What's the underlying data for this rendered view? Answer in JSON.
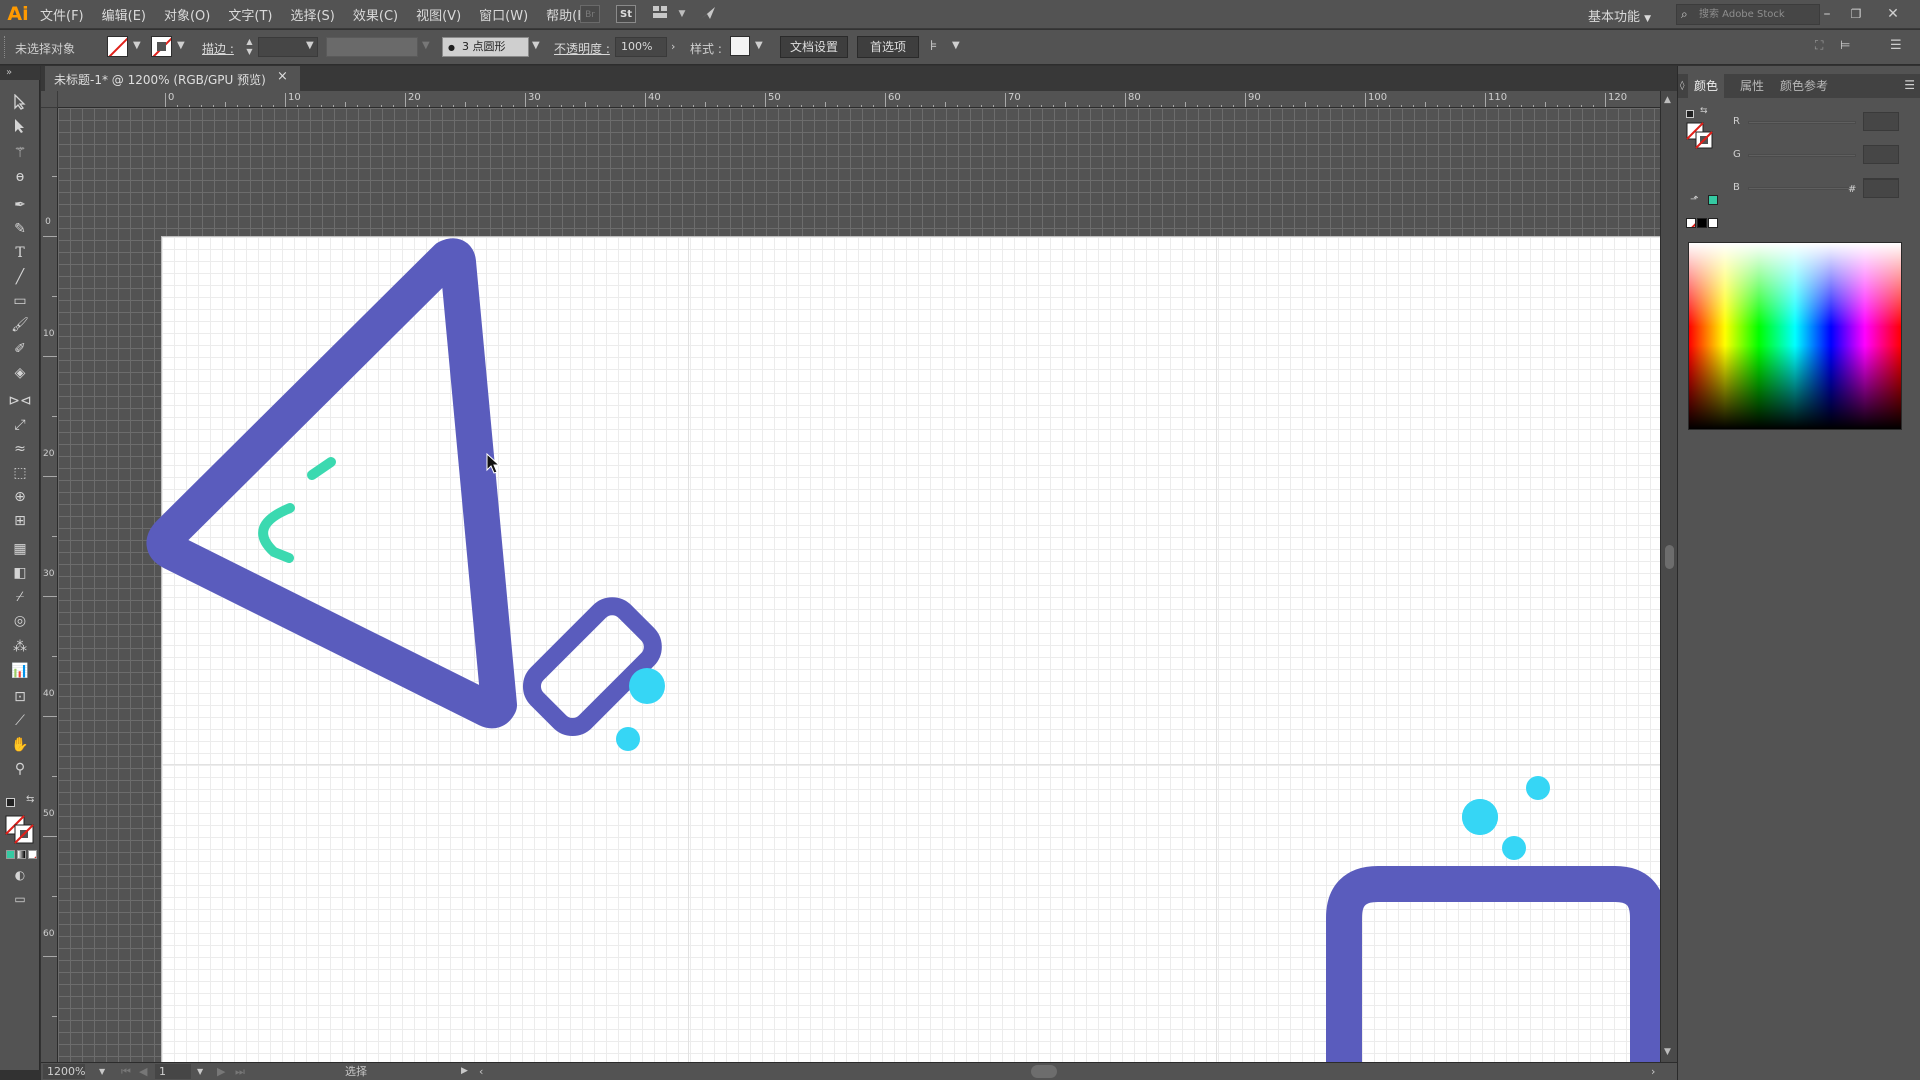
{
  "app": {
    "logo": "Ai"
  },
  "menu": [
    "文件(F)",
    "编辑(E)",
    "对象(O)",
    "文字(T)",
    "选择(S)",
    "效果(C)",
    "视图(V)",
    "窗口(W)",
    "帮助(H)"
  ],
  "menubar_icons": {
    "bridge": "Br",
    "stock": "St"
  },
  "workspace": "基本功能",
  "search": {
    "placeholder": "搜索 Adobe Stock"
  },
  "controlbar": {
    "selection_status": "未选择对象",
    "stroke_label": "描边 :",
    "brush_size": "3",
    "brush_shape": "点圆形",
    "opacity_label": "不透明度 :",
    "opacity_value": "100%",
    "style_label": "样式 :",
    "doc_setup_button": "文档设置",
    "prefs_button": "首选项"
  },
  "document_tab": {
    "title": "未标题-1* @ 1200% (RGB/GPU 预览)",
    "close": "×"
  },
  "ruler": {
    "horizontal": [
      "0",
      "10",
      "20",
      "30",
      "40",
      "50",
      "60",
      "70",
      "80",
      "90",
      "100",
      "110",
      "120"
    ],
    "vertical": [
      "0",
      "10",
      "20",
      "30",
      "40",
      "50",
      "60"
    ]
  },
  "statusbar": {
    "zoom": "1200%",
    "artboard_number": "1",
    "tool_name": "选择"
  },
  "color_panel": {
    "tabs": [
      "颜色",
      "属性",
      "颜色参考"
    ],
    "channels": [
      "R",
      "G",
      "B"
    ],
    "hex_label": "#"
  },
  "colors": {
    "icon_stroke": "#5a5cbd",
    "accent_green": "#3bd9b0",
    "bubble_cyan": "#36d6f5",
    "swatch_green": "#35c9a2"
  },
  "icons": {
    "tools": [
      "selection-tool-icon",
      "direct-selection-tool-icon",
      "magic-wand-icon",
      "lasso-icon",
      "pen-tool-icon",
      "curvature-tool-icon",
      "type-tool-icon",
      "line-segment-icon",
      "rectangle-tool-icon",
      "paintbrush-icon",
      "shaper-tool-icon",
      "eraser-icon",
      "rotate-icon",
      "scale-icon",
      "width-tool-icon",
      "free-transform-icon",
      "shape-builder-icon",
      "perspective-grid-icon",
      "mesh-icon",
      "gradient-icon",
      "eyedropper-icon",
      "blend-icon",
      "symbol-sprayer-icon",
      "column-graph-icon",
      "artboard-tool-icon",
      "slice-icon",
      "hand-icon",
      "zoom-icon"
    ]
  }
}
